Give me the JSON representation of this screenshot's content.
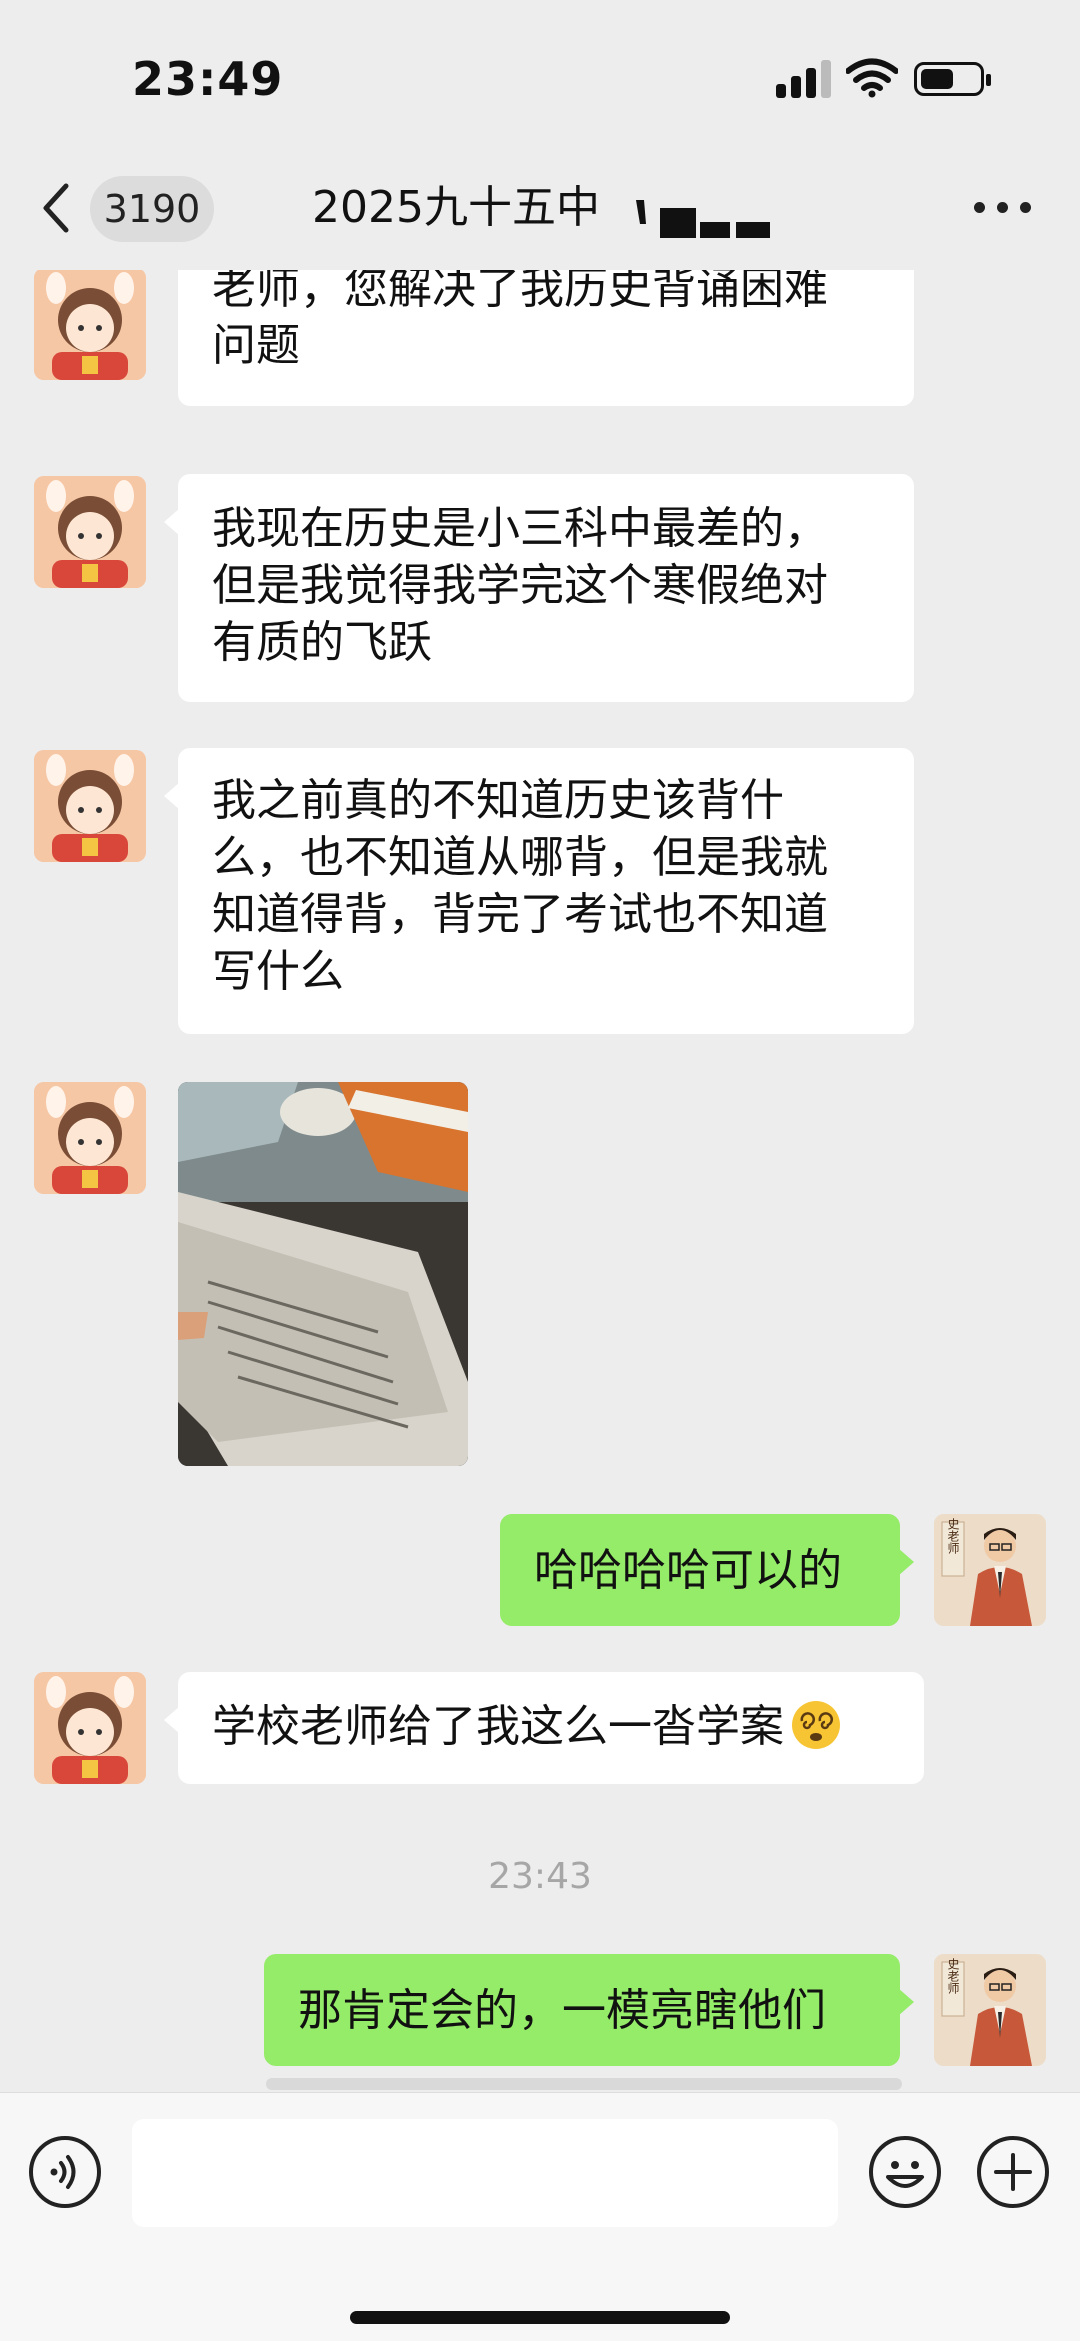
{
  "status_bar": {
    "time": "23:49",
    "icons": [
      "cellular-signal-icon",
      "wifi-icon",
      "battery-icon"
    ]
  },
  "header": {
    "back_icon": "chevron-left-icon",
    "unread_count": "3190",
    "title": "2025九十五中",
    "more_icon": "more-dots-icon"
  },
  "messages": [
    {
      "sender": "student",
      "type": "text",
      "lines": [
        "老师，您解决了我历史背诵困难",
        "问题"
      ]
    },
    {
      "sender": "student",
      "type": "text",
      "lines": [
        "我现在历史是小三科中最差的，",
        "但是我觉得我学完这个寒假绝对",
        "有质的飞跃"
      ]
    },
    {
      "sender": "student",
      "type": "text",
      "lines": [
        "我之前真的不知道历史该背什",
        "么，也不知道从哪背，但是我就",
        "知道得背，背完了考试也不知道",
        "写什么"
      ]
    },
    {
      "sender": "student",
      "type": "image"
    },
    {
      "sender": "me",
      "type": "text",
      "lines": [
        "哈哈哈哈可以的"
      ]
    },
    {
      "sender": "student",
      "type": "text",
      "lines": [
        "学校老师给了我这么一沓学案"
      ],
      "emoji": "dizzy-face-emoji"
    },
    {
      "type": "timestamp",
      "text": "23:43"
    },
    {
      "sender": "me",
      "type": "text",
      "lines": [
        "那肯定会的，一模亮瞎他们"
      ]
    }
  ],
  "avatars": {
    "student": "cartoon-girl-avatar",
    "teacher": {
      "icon": "teacher-portrait-avatar",
      "sign_text": "史老师"
    }
  },
  "input_bar": {
    "voice_icon": "voice-input-icon",
    "input_value": "",
    "emoji_icon": "emoji-smile-icon",
    "plus_icon": "plus-circle-icon"
  },
  "colors": {
    "background": "#ededed",
    "incoming_bubble": "#ffffff",
    "outgoing_bubble": "#95ec69",
    "timestamp": "#a6a6a6"
  }
}
